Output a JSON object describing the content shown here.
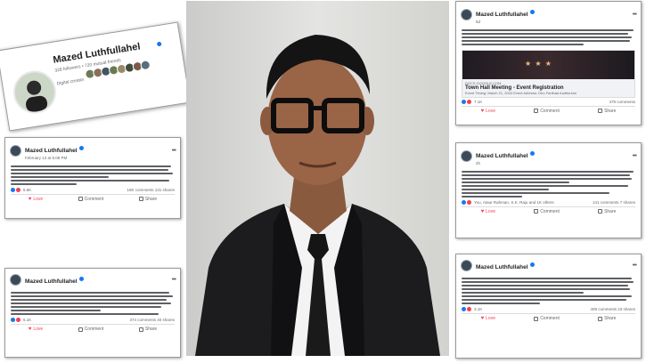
{
  "profile": {
    "name": "Mazed Luthfullahel",
    "subline": "328 followers • 720 mutual friends",
    "category": "Digital creator"
  },
  "posts": [
    {
      "name": "Mazed Luthfullahel",
      "time": "February 13 at 5:08 PM",
      "reactions": "6.6K",
      "comments_shares": "18K comments 131 shares",
      "actions": [
        "Love",
        "Comment",
        "Share"
      ]
    },
    {
      "name": "Mazed Luthfullahel",
      "time": "",
      "reactions": "6.1K",
      "comments_shares": "374 comments 40 shares",
      "actions": [
        "Love",
        "Comment",
        "Share"
      ]
    },
    {
      "name": "Mazed Luthfullahel",
      "time": "5d",
      "reactions": "7.1K",
      "comments_shares": "479 comments",
      "actions": [
        "Love",
        "Comment",
        "Share"
      ],
      "event": {
        "domain": "DOCS.GOOGLE.COM",
        "title": "Town Hall Meeting - Event Registration",
        "desc": "Event Timing: March 21, 2024 Event Address: Dhu Fariihad Auditorium"
      }
    },
    {
      "name": "Mazed Luthfullahel",
      "time": "2h",
      "reactions": "You, Ataur Rahman, S.K. Raju and 1K others",
      "comments_shares": "141 comments 7 shares",
      "actions": [
        "Love",
        "Comment",
        "Share"
      ]
    },
    {
      "name": "Mazed Luthfullahel",
      "time": "",
      "reactions": "3.1K",
      "comments_shares": "409 comments 23 shares",
      "actions": [
        "Love",
        "Comment",
        "Share"
      ]
    }
  ]
}
